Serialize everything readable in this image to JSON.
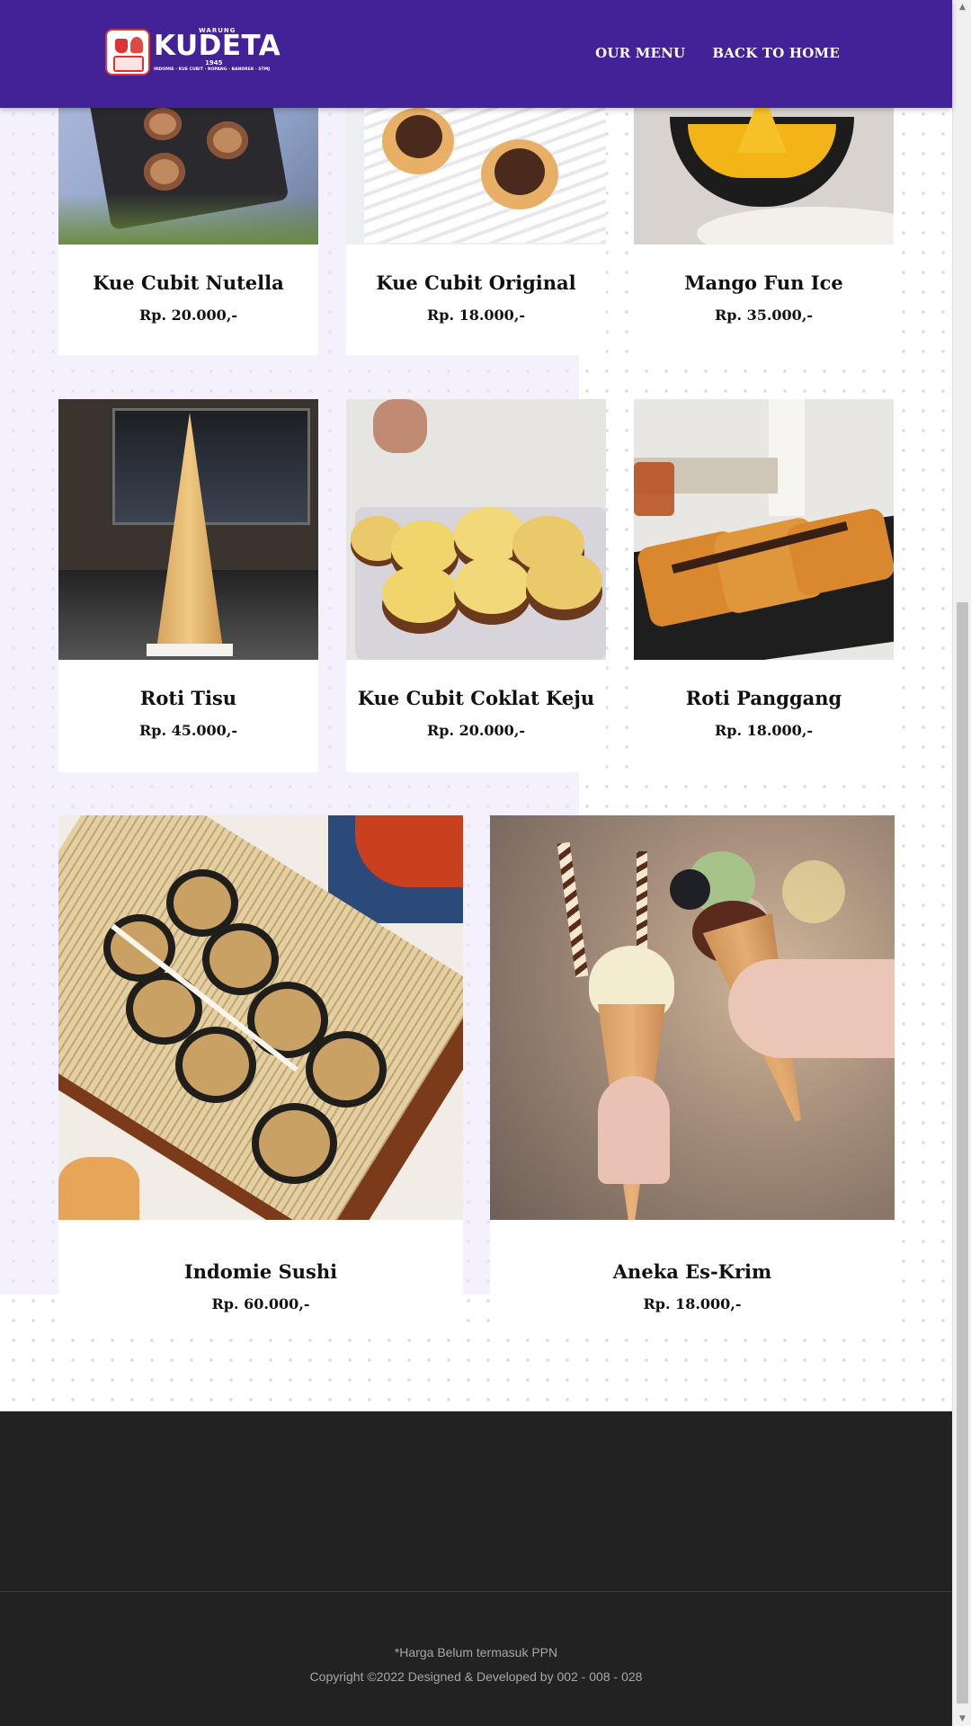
{
  "header": {
    "logo": {
      "top_text": "WARUNG",
      "name": "KUDETA",
      "year": "1945",
      "tagline": "INDOMIE · KUE CUBIT · ROPANG · BANDREK · STMJ"
    },
    "nav": {
      "our_menu": "OUR MENU",
      "back_home": "BACK TO HOME"
    }
  },
  "menu": {
    "items": [
      {
        "name": "Kue Cubit Nutella",
        "price": "Rp. 20.000,-"
      },
      {
        "name": "Kue Cubit Original",
        "price": "Rp. 18.000,-"
      },
      {
        "name": "Mango Fun Ice",
        "price": "Rp. 35.000,-"
      },
      {
        "name": "Roti Tisu",
        "price": "Rp. 45.000,-"
      },
      {
        "name": "Kue Cubit Coklat Keju",
        "price": "Rp. 20.000,-"
      },
      {
        "name": "Roti Panggang",
        "price": "Rp. 18.000,-"
      },
      {
        "name": "Indomie Sushi",
        "price": "Rp. 60.000,-"
      },
      {
        "name": "Aneka Es-Krim",
        "price": "Rp. 18.000,-"
      }
    ]
  },
  "footer": {
    "note": "*Harga Belum termasuk PPN",
    "copyright": "Copyright ©2022 Designed & Developed by 002 - 008 - 028"
  },
  "colors": {
    "header_bg": "#432197",
    "footer_bg": "#222222",
    "lavender": "#f4f1fd"
  }
}
